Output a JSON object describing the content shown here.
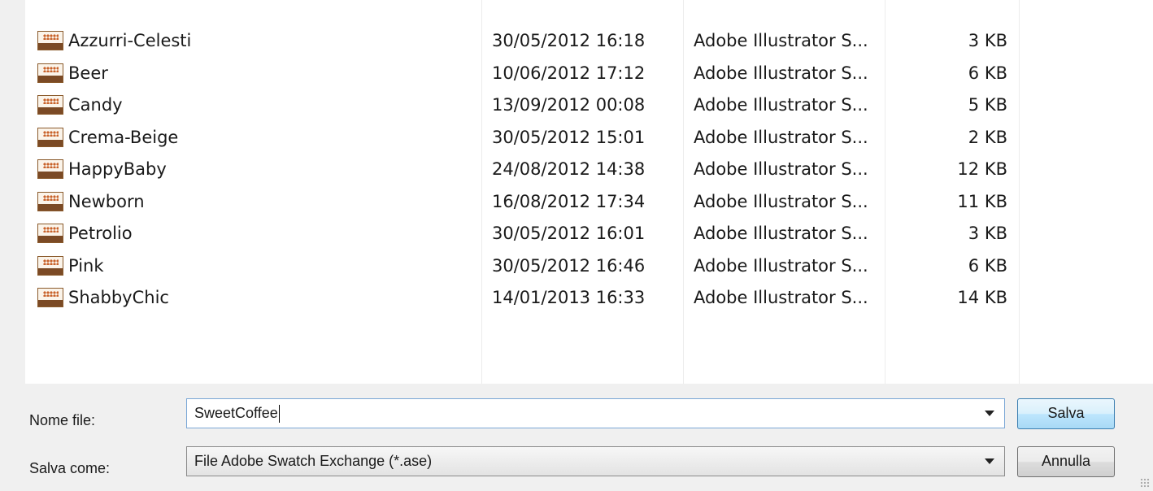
{
  "file_list": {
    "rows": [
      {
        "name": "Azzurri-Celesti",
        "modified": "30/05/2012 16:18",
        "type": "Adobe Illustrator S...",
        "size": "3 KB"
      },
      {
        "name": "Beer",
        "modified": "10/06/2012 17:12",
        "type": "Adobe Illustrator S...",
        "size": "6 KB"
      },
      {
        "name": "Candy",
        "modified": "13/09/2012 00:08",
        "type": "Adobe Illustrator S...",
        "size": "5 KB"
      },
      {
        "name": "Crema-Beige",
        "modified": "30/05/2012 15:01",
        "type": "Adobe Illustrator S...",
        "size": "2 KB"
      },
      {
        "name": "HappyBaby",
        "modified": "24/08/2012 14:38",
        "type": "Adobe Illustrator S...",
        "size": "12 KB"
      },
      {
        "name": "Newborn",
        "modified": "16/08/2012 17:34",
        "type": "Adobe Illustrator S...",
        "size": "11 KB"
      },
      {
        "name": "Petrolio",
        "modified": "30/05/2012 16:01",
        "type": "Adobe Illustrator S...",
        "size": "3 KB"
      },
      {
        "name": "Pink",
        "modified": "30/05/2012 16:46",
        "type": "Adobe Illustrator S...",
        "size": "6 KB"
      },
      {
        "name": "ShabbyChic",
        "modified": "14/01/2013 16:33",
        "type": "Adobe Illustrator S...",
        "size": "14 KB"
      }
    ],
    "icon": "ase-swatch-file-icon"
  },
  "form": {
    "filename_label": "Nome file:",
    "filename_value": "SweetCoffee",
    "filetype_label": "Salva come:",
    "filetype_value": "File Adobe Swatch Exchange (*.ase)"
  },
  "buttons": {
    "save_label": "Salva",
    "cancel_label": "Annulla"
  },
  "colors": {
    "list_background": "#ffffff",
    "dialog_background": "#f0f0f0",
    "save_button_accent": "#3c7fb1"
  }
}
